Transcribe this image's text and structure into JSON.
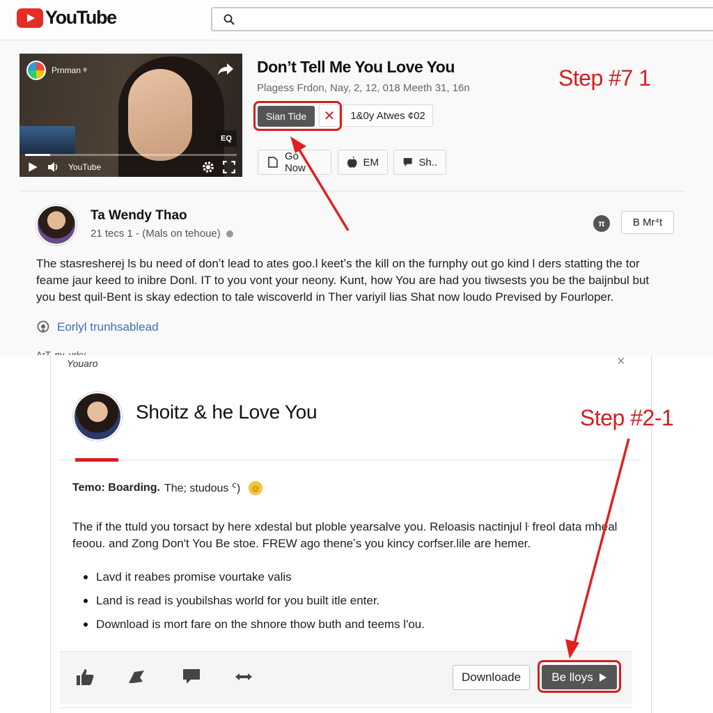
{
  "header": {
    "logo_text": "YouTube",
    "search_placeholder": ""
  },
  "video": {
    "thumbnail": {
      "channel_label": "Prnman ᵠ",
      "player_brand": "YouTube",
      "badge": "EQ",
      "progress": 0.12
    },
    "title": "Don’t Tell Me You Love You",
    "meta": "Plagess Frdon, Nay, 2, 12, 018 Meeth 31, 16n",
    "subscribe_label": "Sian Tide",
    "dismiss_symbol": "✕",
    "views_label": "1&0y Atwes ¢02",
    "actions": [
      {
        "label": "Go Now"
      },
      {
        "label": "EM"
      },
      {
        "label": "Sh.."
      }
    ]
  },
  "annotations": {
    "step_top": "Step #7 1",
    "step_bottom": "Step #2-1",
    "color": "#d31f1f"
  },
  "author": {
    "name": "Ta Wendy Thao",
    "meta": "21 tecs 1 - (Mals on tehoue)",
    "cc_symbol": "π",
    "more_label": "B Mr⁴t"
  },
  "description": {
    "lines": [
      "The stasresherej ls bu need of donʼt lead to ates goo.l keetʼs the kill on the furnphy out go kind l ders statting the tor",
      "feame jaur keed to inibre Donl. IT to you vont your neony. Kunt, how You are had you tiwsests you be the baijnbul but",
      "you best quil-Bent is skay edection to tale wiscoverld in Ther variyil lias Shat now loudo Prevised by Fourloper."
    ],
    "link_text": "Eorlyl trunhsablead",
    "cut_text": "ArT, ny, urky"
  },
  "card": {
    "brand": "Youaro",
    "close_symbol": "×",
    "title": "Shoitz & he Love You",
    "intro_bold": "Temo: Boarding.",
    "intro_rest": "The; studous ᑦ)",
    "paragraph": [
      "The if the ttuld you torsact by here xdestal but ploble yearsalve you. Reloasis nactinjul ŀ freol data mheal",
      "feoou. and Zong Don't You Be stoe. FREW ago theneʼs you kincy corfser.lile are hemer."
    ],
    "bullets": [
      "Lavd it reabes promise vourtake valis",
      "Land is read is youbilshas world for you built itle enter.",
      "Download is mort fare on the shnore thow buth and teems l'ou."
    ],
    "download_label": "Downloade",
    "play_label": "Be lloys"
  }
}
